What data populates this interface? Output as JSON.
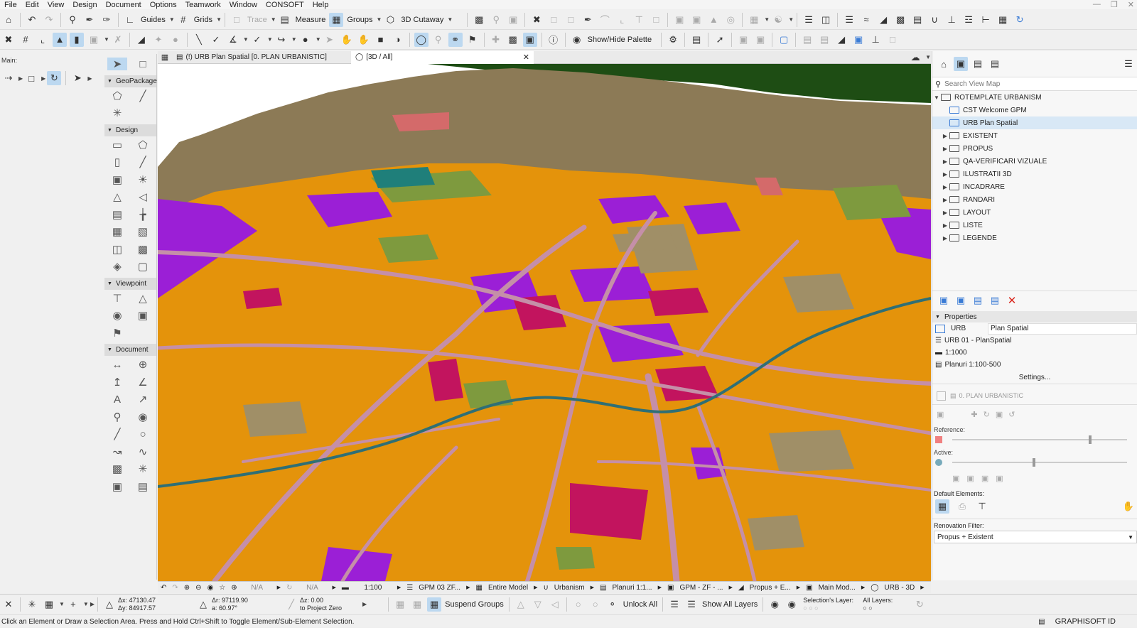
{
  "menu": [
    "File",
    "Edit",
    "View",
    "Design",
    "Document",
    "Options",
    "Teamwork",
    "Window",
    "CONSOFT",
    "Help"
  ],
  "toolbar1": {
    "guides": "Guides",
    "grids": "Grids",
    "trace": "Trace",
    "measure": "Measure",
    "groups": "Groups",
    "cutaway": "3D Cutaway"
  },
  "toolbar2": {
    "show_hide_palette": "Show/Hide Palette"
  },
  "main_label": "Main:",
  "toolbox": {
    "sections": [
      "GeoPackage",
      "Design",
      "Viewpoint",
      "Document"
    ]
  },
  "tabs": {
    "plan": "(!) URB Plan Spatial [0. PLAN URBANISTIC]",
    "view3d": "[3D / All]"
  },
  "navigator": {
    "search_placeholder": "Search View Map",
    "root": "ROTEMPLATE URBANISM",
    "items": [
      "CST Welcome GPM",
      "URB Plan Spatial",
      "EXISTENT",
      "PROPUS",
      "QA-VERIFICARI VIZUALE",
      "ILUSTRATII 3D",
      "INCADRARE",
      "RANDARI",
      "LAYOUT",
      "LISTE",
      "LEGENDE"
    ]
  },
  "properties": {
    "title": "Properties",
    "id": "URB",
    "name": "Plan Spatial",
    "set": "URB 01 - PlanSpatial",
    "scale": "1:1000",
    "pen": "Planuri 1:100-500",
    "settings": "Settings...",
    "layer": "0. PLAN URBANISTIC",
    "reference": "Reference:",
    "active": "Active:",
    "default_elements": "Default Elements:",
    "renovation_filter": "Renovation Filter:",
    "renovation_value": "Propus + Existent"
  },
  "viewbar": {
    "na1": "N/A",
    "na2": "N/A",
    "scale": "1:100",
    "gpm": "GPM 03 ZF...",
    "model": "Entire Model",
    "struct": "Urbanism",
    "pen": "Planuri 1:1...",
    "mvo": "GPM - ZF - ...",
    "reno": "Propus + E...",
    "main": "Main Mod...",
    "urb": "URB - 3D"
  },
  "coords": {
    "dx": "Δx: 47130.47",
    "dy": "Δy: 84917.57",
    "dr": "Δr: 97119.90",
    "angle": "a: 60.97°",
    "dz": "Δz: 0.00",
    "project_zero": "to Project Zero"
  },
  "actions": {
    "suspend": "Suspend Groups",
    "unlock": "Unlock All",
    "show_layers": "Show All Layers",
    "sel_layer": "Selection's Layer:",
    "all_layers": "All Layers:"
  },
  "status": {
    "hint": "Click an Element or Draw a Selection Area. Press and Hold Ctrl+Shift to Toggle Element/Sub-Element Selection.",
    "brand": "GRAPHISOFT ID"
  },
  "colors": {
    "orange": "#e4930b",
    "purple": "#9b1fd6",
    "magenta": "#c2145e",
    "olive": "#7e9a3e",
    "khaki": "#a08f67",
    "road": "#c58fa8",
    "river": "#2f6f75",
    "sky": "#ffffff",
    "terrain": "#8c7a56"
  }
}
